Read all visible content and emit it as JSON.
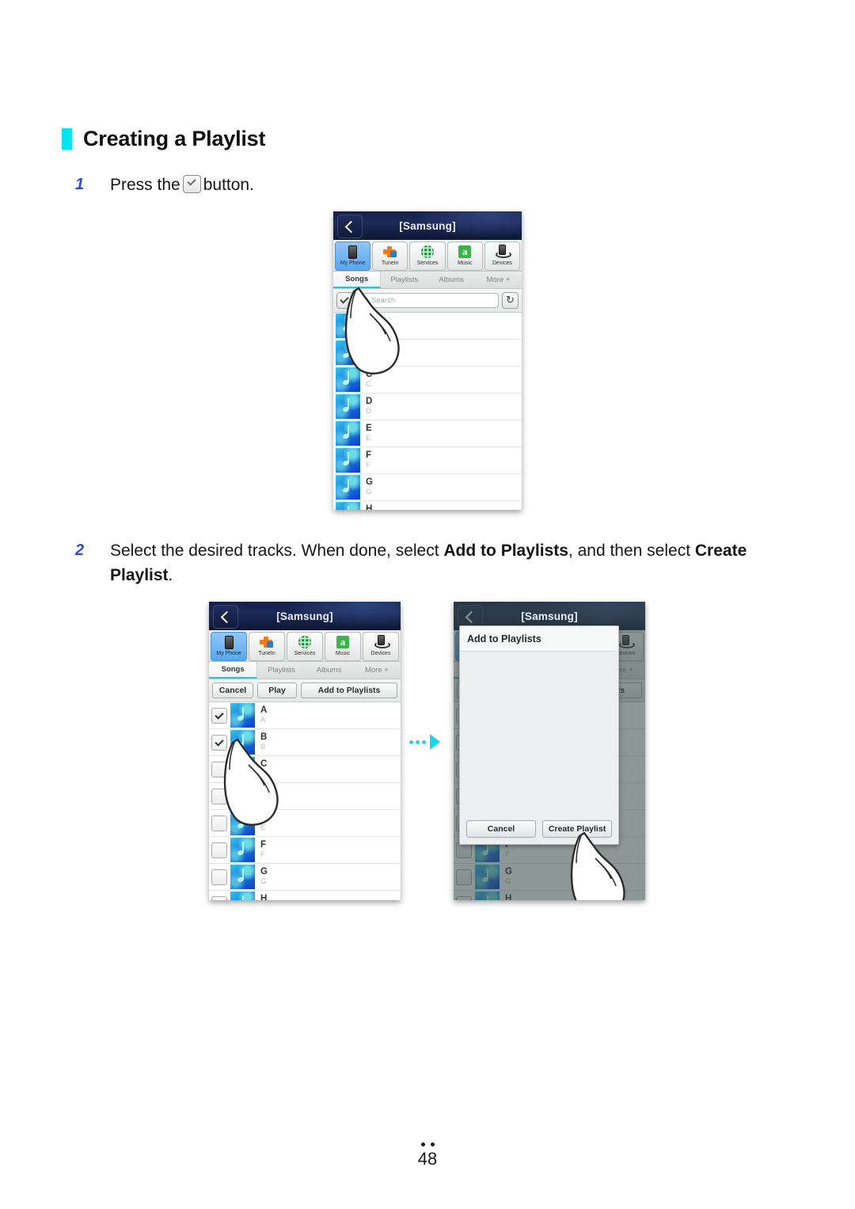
{
  "heading": {
    "text": "Creating a Playlist",
    "accent_color": "#00e5f0"
  },
  "steps": [
    {
      "number": "1",
      "text_before": "Press the",
      "icon": "checkbox-icon",
      "text_after": "button."
    },
    {
      "number": "2",
      "part1": "Select the desired tracks. When done, select ",
      "bold1": "Add to Playlists",
      "part2": ", and then select ",
      "bold2": "Create",
      "part3": "Playlist",
      "part4": "."
    }
  ],
  "device": {
    "titlebar": {
      "title": "[Samsung]",
      "back_icon": "back-chevron-icon"
    },
    "source_tabs": [
      {
        "label": "My Phone",
        "icon": "phone-icon",
        "active": true
      },
      {
        "label": "TuneIn",
        "icon": "tunein-icon",
        "active": false
      },
      {
        "label": "Services",
        "icon": "globe-icon",
        "active": false
      },
      {
        "label": "Music",
        "icon": "amazon-music-icon",
        "active": false
      },
      {
        "label": "Devices",
        "icon": "dock-icon",
        "active": false
      }
    ],
    "category_tabs": [
      {
        "label": "Songs",
        "active": true
      },
      {
        "label": "Playlists",
        "active": false
      },
      {
        "label": "Albums",
        "active": false
      },
      {
        "label": "More +",
        "active": false
      }
    ],
    "search": {
      "placeholder": "Search",
      "select_all_icon": "checkbox-icon",
      "refresh_icon": "refresh-icon",
      "search_icon": "magnifier-icon"
    },
    "action_buttons": {
      "cancel": "Cancel",
      "play": "Play",
      "add_to_playlists": "Add to Playlists"
    },
    "songs": [
      {
        "title": "A",
        "subtitle": "A",
        "checked": true
      },
      {
        "title": "B",
        "subtitle": "B",
        "checked": true
      },
      {
        "title": "C",
        "subtitle": "C",
        "checked": false
      },
      {
        "title": "D",
        "subtitle": "D",
        "checked": false
      },
      {
        "title": "E",
        "subtitle": "E",
        "checked": false
      },
      {
        "title": "F",
        "subtitle": "F",
        "checked": false
      },
      {
        "title": "G",
        "subtitle": "G",
        "checked": false
      },
      {
        "title": "H",
        "subtitle": "H",
        "checked": false
      }
    ]
  },
  "dialog": {
    "title": "Add to Playlists",
    "cancel": "Cancel",
    "create": "Create Playlist"
  },
  "flow_arrow": {
    "icon": "dotted-arrow-right-icon",
    "color": "#15d8ea"
  },
  "footer": {
    "page_number": "48"
  }
}
